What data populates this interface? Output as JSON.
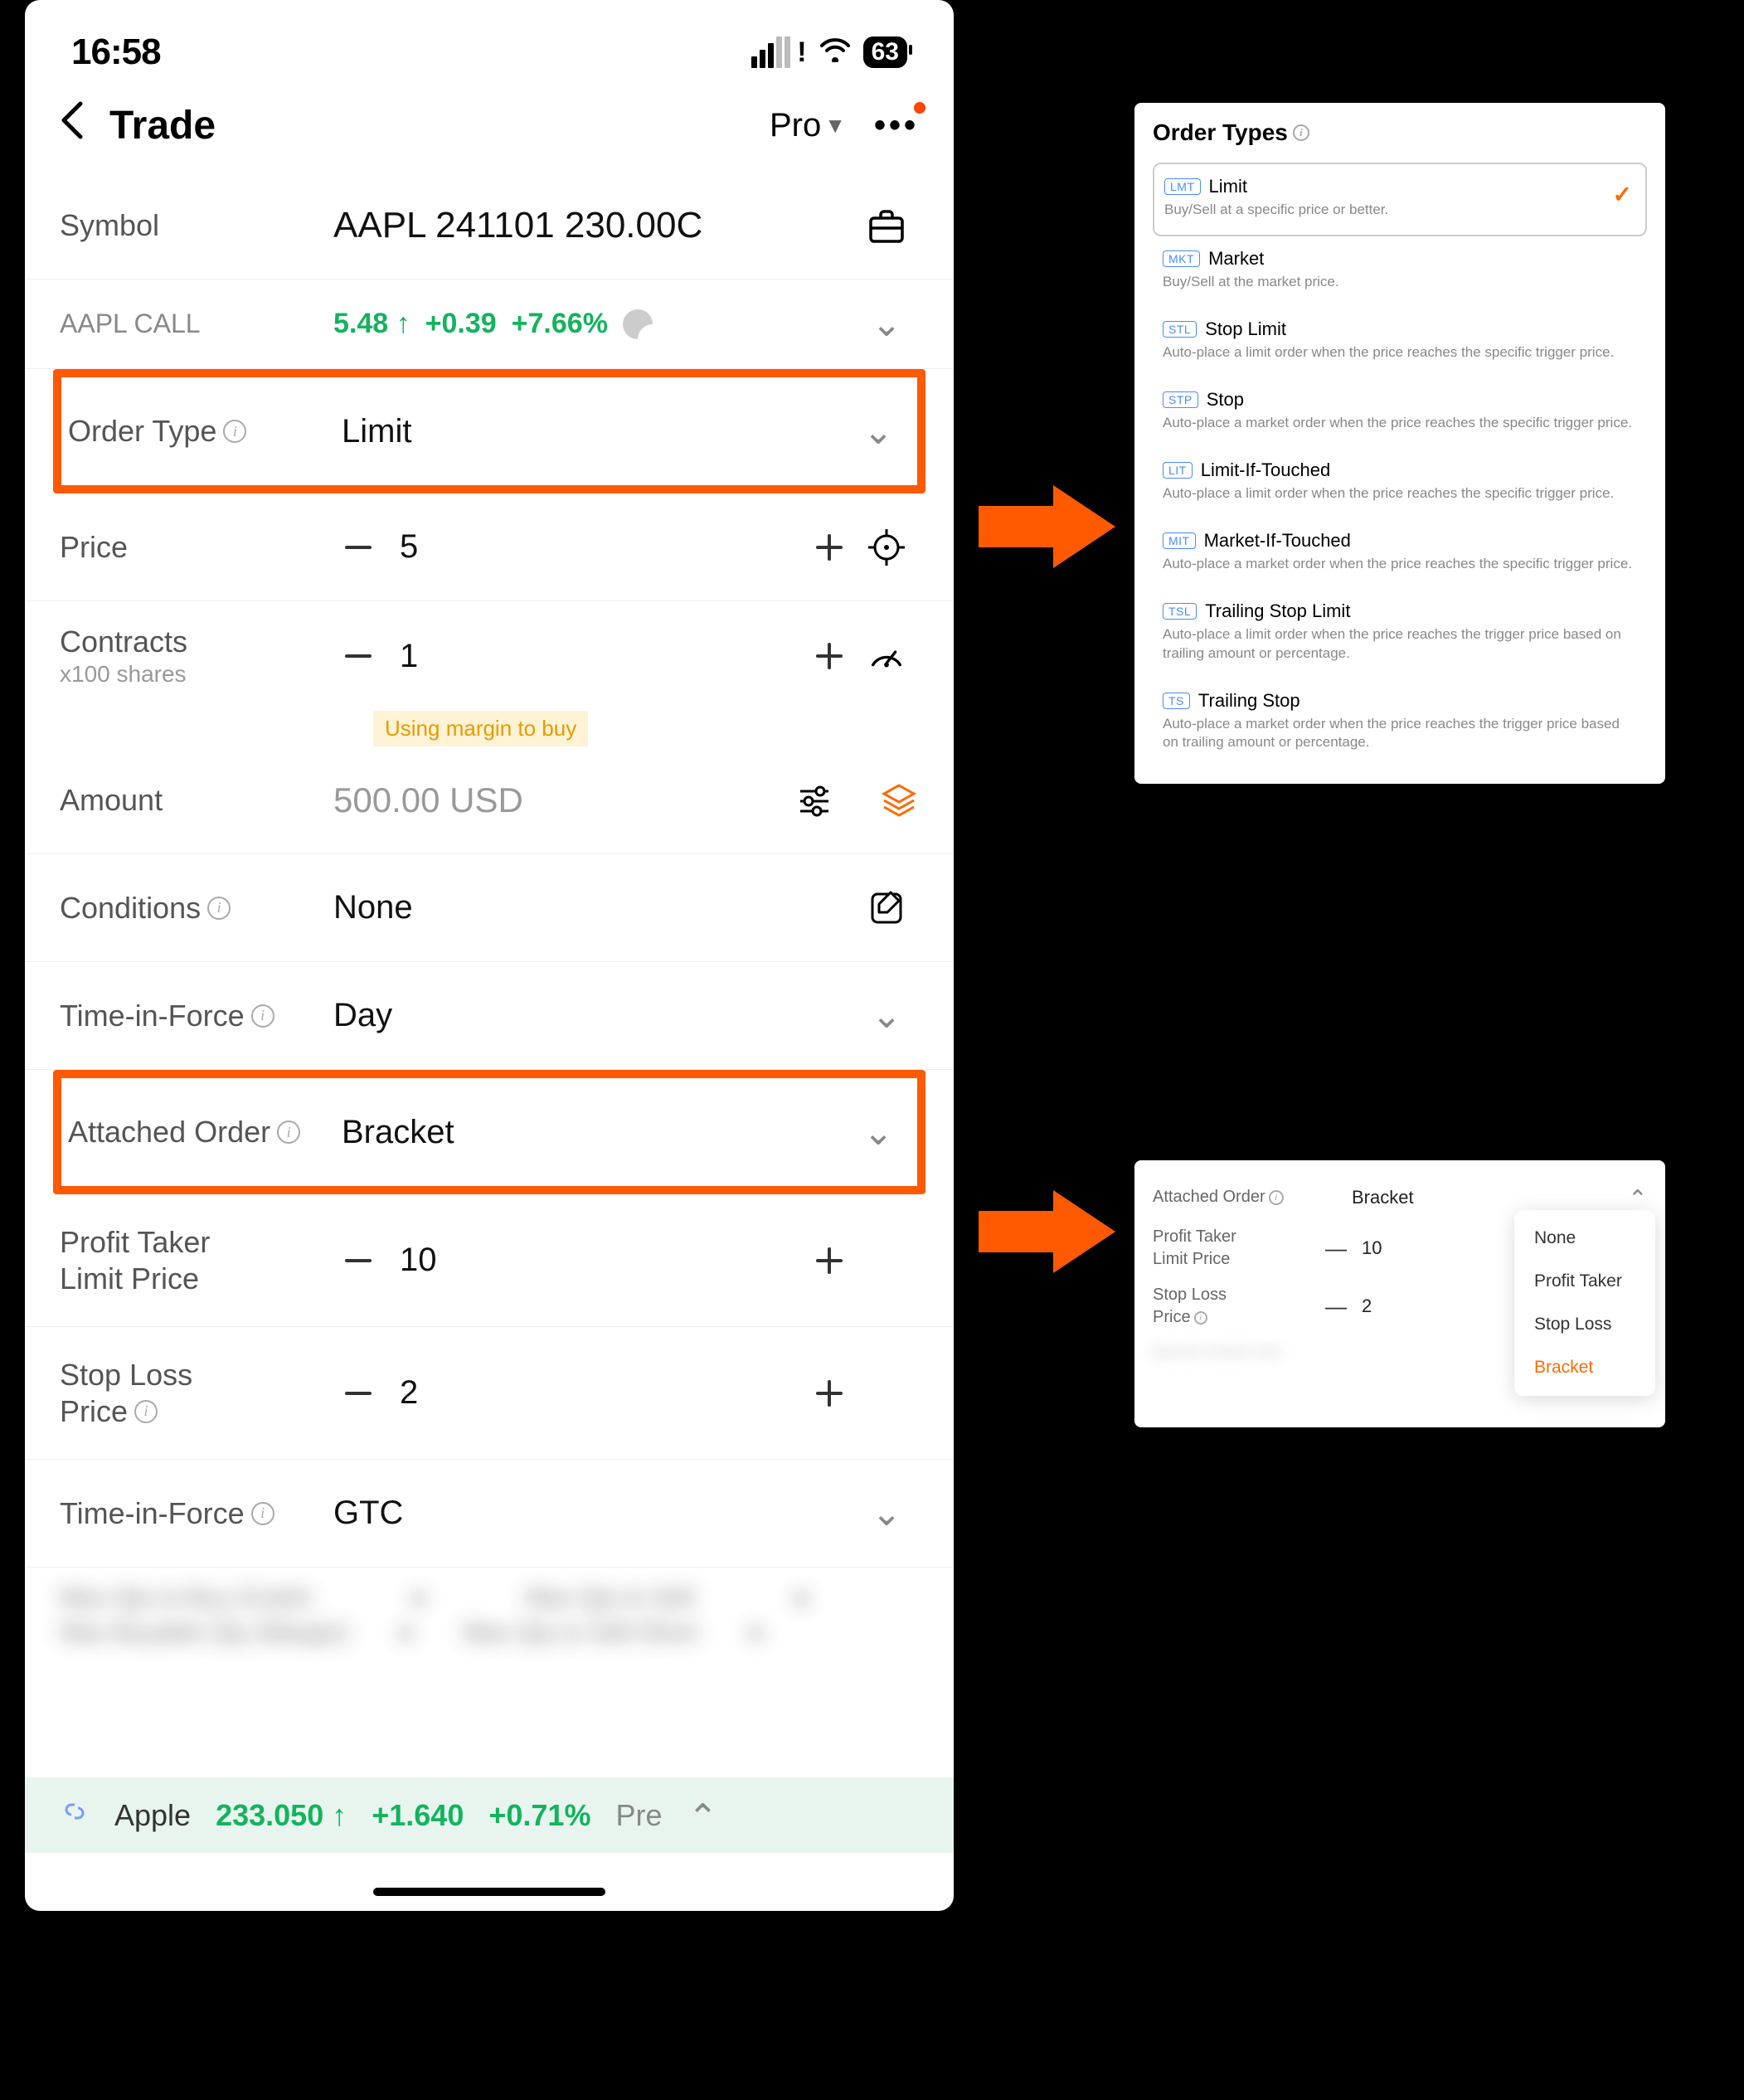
{
  "status": {
    "time": "16:58",
    "battery": "63"
  },
  "nav": {
    "title": "Trade",
    "mode": "Pro"
  },
  "trade": {
    "symbol_label": "Symbol",
    "symbol_value": "AAPL 241101 230.00C",
    "leg_name": "AAPL CALL",
    "leg_price": "5.48",
    "leg_change": "+0.39",
    "leg_pct": "+7.66%",
    "order_type_label": "Order Type",
    "order_type_value": "Limit",
    "price_label": "Price",
    "price_value": "5",
    "contracts_label": "Contracts",
    "contracts_sub": "x100 shares",
    "contracts_value": "1",
    "margin_tag": "Using margin to buy",
    "amount_label": "Amount",
    "amount_value": "500.00 USD",
    "conditions_label": "Conditions",
    "conditions_value": "None",
    "tif_label": "Time-in-Force",
    "tif_value": "Day",
    "attached_label": "Attached Order",
    "attached_value": "Bracket",
    "pt_label_line1": "Profit Taker",
    "pt_label_line2": "Limit Price",
    "pt_value": "10",
    "sl_label_line1": "Stop Loss",
    "sl_label_line2": "Price",
    "sl_value": "2",
    "tif2_label": "Time-in-Force",
    "tif2_value": "GTC",
    "blur1": "Max Qty to Buy (Cash)",
    "blur2": "Max Qty to Sell",
    "blur3": "Max Buyable Qty (Margin)",
    "blur4": "Max Qty to Sell Short",
    "ticker_name": "Apple",
    "ticker_price": "233.050",
    "ticker_change": "+1.640",
    "ticker_pct": "+0.71%",
    "ticker_session": "Pre"
  },
  "order_types_panel": {
    "title": "Order Types",
    "items": [
      {
        "tag": "LMT",
        "name": "Limit",
        "desc": "Buy/Sell at a specific price or better.",
        "selected": true
      },
      {
        "tag": "MKT",
        "name": "Market",
        "desc": "Buy/Sell at the market price."
      },
      {
        "tag": "STL",
        "name": "Stop Limit",
        "desc": "Auto-place a limit order when the price reaches the specific trigger price."
      },
      {
        "tag": "STP",
        "name": "Stop",
        "desc": "Auto-place a market order when the price reaches the specific trigger price."
      },
      {
        "tag": "LIT",
        "name": "Limit-If-Touched",
        "desc": "Auto-place a limit order when the price reaches the specific trigger price."
      },
      {
        "tag": "MIT",
        "name": "Market-If-Touched",
        "desc": "Auto-place a market order when the price reaches the specific trigger price."
      },
      {
        "tag": "TSL",
        "name": "Trailing Stop Limit",
        "desc": "Auto-place a limit order when the price reaches the trigger price based on trailing amount or percentage."
      },
      {
        "tag": "TS",
        "name": "Trailing Stop",
        "desc": "Auto-place a market order when the price reaches the trigger price based on trailing amount or percentage."
      }
    ]
  },
  "attached_panel": {
    "label": "Attached Order",
    "value": "Bracket",
    "pt_label_line1": "Profit Taker",
    "pt_label_line2": "Limit Price",
    "pt_value": "10",
    "sl_label_line1": "Stop Loss",
    "sl_label_line2": "Price",
    "sl_value": "2",
    "options": [
      "None",
      "Profit Taker",
      "Stop Loss",
      "Bracket"
    ],
    "selected": "Bracket"
  }
}
